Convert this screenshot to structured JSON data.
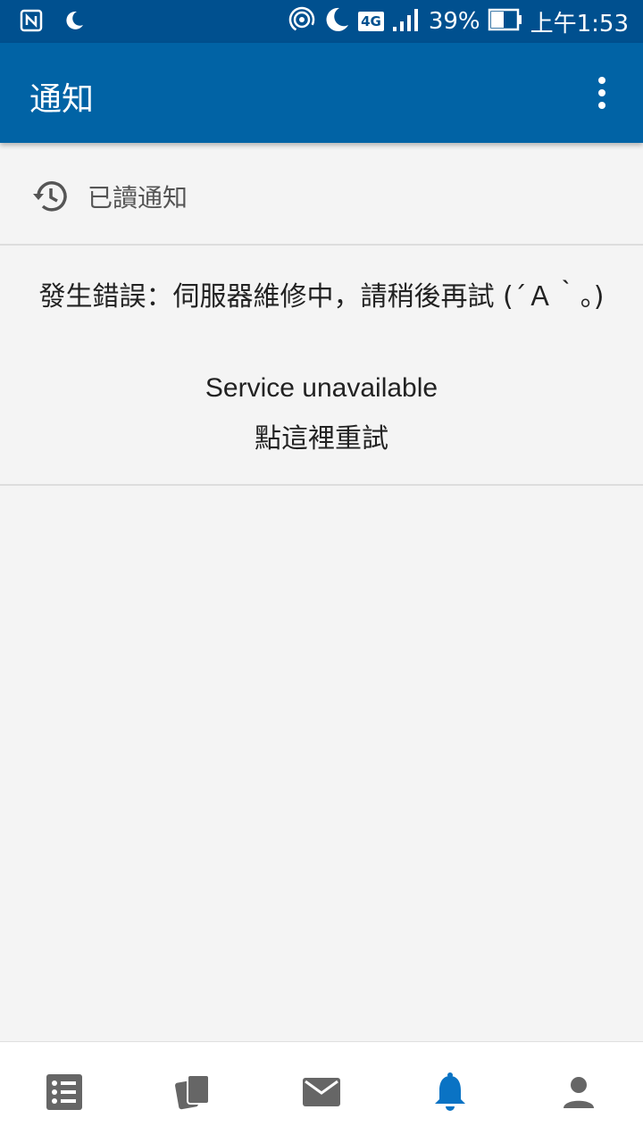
{
  "status_bar": {
    "network_badge": "4G",
    "battery_percent": "39%",
    "time": "上午1:53",
    "icons": [
      "nfc-icon",
      "moon-icon",
      "hotspot-icon",
      "moon-icon",
      "signal-icon",
      "battery-icon"
    ]
  },
  "app_bar": {
    "title": "通知",
    "menu_icon": "more-vert-icon"
  },
  "read_notifications": {
    "label": "已讀通知",
    "icon": "history-icon"
  },
  "error": {
    "message": "發生錯誤：伺服器維修中，請稍後再試 (´Ａ｀。)",
    "detail": "Service unavailable",
    "retry_label": "點這裡重試"
  },
  "bottom_nav": {
    "items": [
      {
        "name": "list",
        "icon": "list-icon"
      },
      {
        "name": "cards",
        "icon": "cards-icon"
      },
      {
        "name": "mail",
        "icon": "mail-icon"
      },
      {
        "name": "notifications",
        "icon": "bell-icon",
        "active": true
      },
      {
        "name": "profile",
        "icon": "person-icon"
      }
    ]
  },
  "colors": {
    "status_bar": "#00508f",
    "app_bar": "#0163a5",
    "active_nav": "#0a73c4",
    "inactive_nav": "#666666"
  }
}
